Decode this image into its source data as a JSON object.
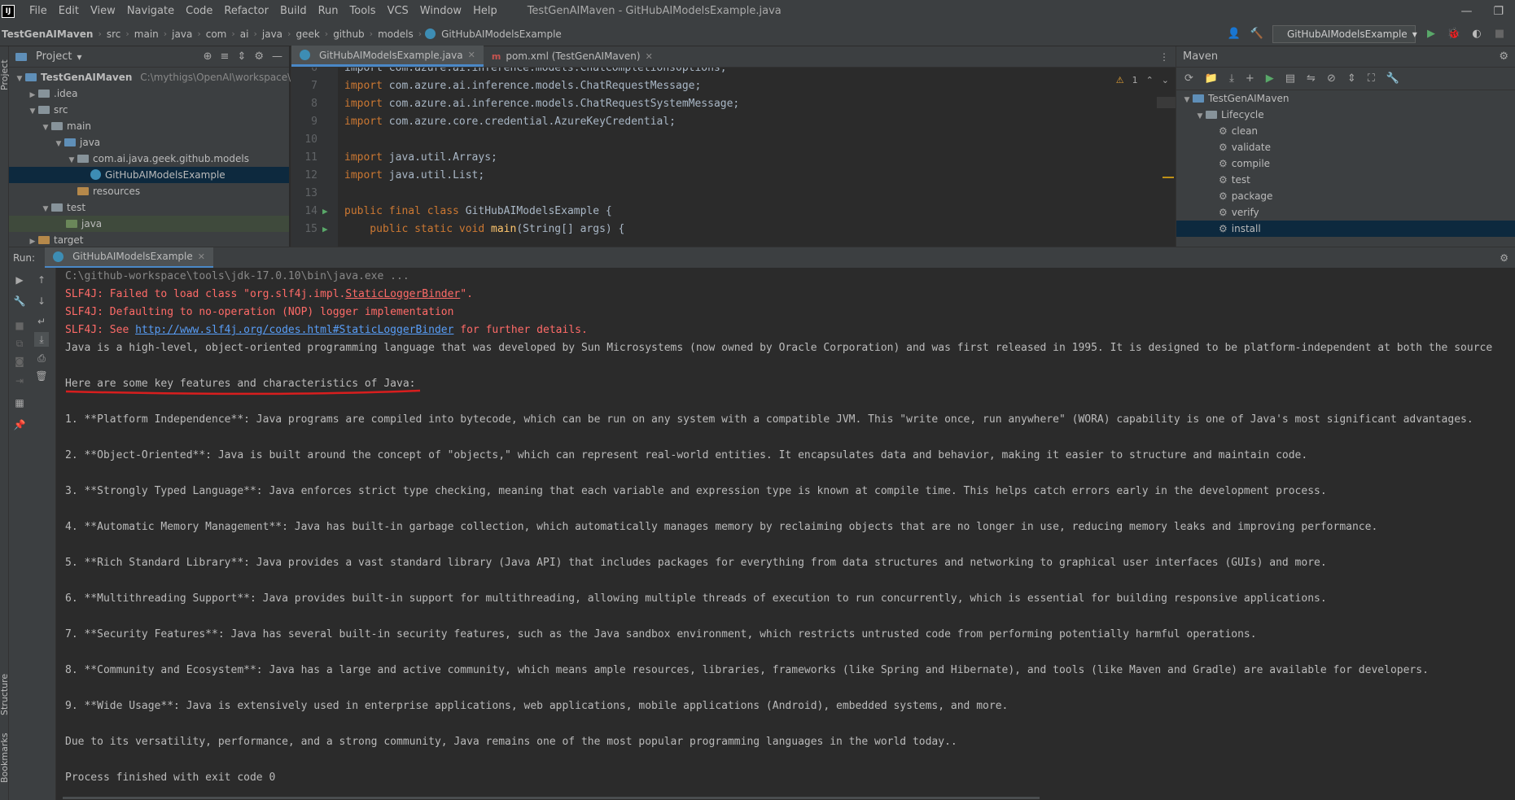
{
  "menubar": {
    "items": [
      "File",
      "Edit",
      "View",
      "Navigate",
      "Code",
      "Refactor",
      "Build",
      "Run",
      "Tools",
      "VCS",
      "Window",
      "Help"
    ],
    "window_title": "TestGenAIMaven - GitHubAIModelsExample.java"
  },
  "breadcrumb": [
    "TestGenAIMaven",
    "src",
    "main",
    "java",
    "com",
    "ai",
    "java",
    "geek",
    "github",
    "models",
    "GitHubAIModelsExample"
  ],
  "run_config": "GitHubAIModelsExample",
  "project": {
    "title": "Project",
    "root": "TestGenAIMaven",
    "root_path": "C:\\mythigs\\OpenAI\\workspace\\TestG",
    "items": [
      ".idea",
      "src",
      "main",
      "java",
      "com.ai.java.geek.github.models",
      "GitHubAIModelsExample",
      "resources",
      "test",
      "java",
      "target"
    ]
  },
  "editor": {
    "tabs": [
      "GitHubAIModelsExample.java",
      "pom.xml (TestGenAIMaven)"
    ],
    "warning_count": "1",
    "lines": [
      {
        "n": "6",
        "text": "import com.azure.ai.inference.models.ChatCompletionsOptions;"
      },
      {
        "n": "7",
        "text": "import com.azure.ai.inference.models.ChatRequestMessage;"
      },
      {
        "n": "8",
        "text": "import com.azure.ai.inference.models.ChatRequestSystemMessage;"
      },
      {
        "n": "9",
        "text": "import com.azure.core.credential.AzureKeyCredential;"
      },
      {
        "n": "10",
        "text": ""
      },
      {
        "n": "11",
        "text": "import java.util.Arrays;"
      },
      {
        "n": "12",
        "text": "import java.util.List;"
      },
      {
        "n": "13",
        "text": ""
      },
      {
        "n": "14",
        "text": "public final class GitHubAIModelsExample {"
      },
      {
        "n": "15",
        "text": "    public static void main(String[] args) {"
      }
    ]
  },
  "maven": {
    "title": "Maven",
    "project": "TestGenAIMaven",
    "lifecycle": "Lifecycle",
    "goals": [
      "clean",
      "validate",
      "compile",
      "test",
      "package",
      "verify",
      "install"
    ]
  },
  "run": {
    "label": "Run:",
    "tab": "GitHubAIModelsExample",
    "console": {
      "cmd": "C:\\github-workspace\\tools\\jdk-17.0.10\\bin\\java.exe ...",
      "err1_a": "SLF4J: Failed to load class \"org.slf4j.impl.",
      "err1_b": "StaticLoggerBinder",
      "err1_c": "\".",
      "err2": "SLF4J: Defaulting to no-operation (NOP) logger implementation",
      "err3_a": "SLF4J: See ",
      "err3_link": "http://www.slf4j.org/codes.html#StaticLoggerBinder",
      "err3_c": " for further details.",
      "intro": "Java is a high-level, object-oriented programming language that was developed by Sun Microsystems (now owned by Oracle Corporation) and was first released in 1995. It is designed to be platform-independent at both the source",
      "heading": "Here are some key features and characteristics of Java:",
      "points": [
        "1. **Platform Independence**: Java programs are compiled into bytecode, which can be run on any system with a compatible JVM. This \"write once, run anywhere\" (WORA) capability is one of Java's most significant advantages.",
        "2. **Object-Oriented**: Java is built around the concept of \"objects,\" which can represent real-world entities. It encapsulates data and behavior, making it easier to structure and maintain code.",
        "3. **Strongly Typed Language**: Java enforces strict type checking, meaning that each variable and expression type is known at compile time. This helps catch errors early in the development process.",
        "4. **Automatic Memory Management**: Java has built-in garbage collection, which automatically manages memory by reclaiming objects that are no longer in use, reducing memory leaks and improving performance.",
        "5. **Rich Standard Library**: Java provides a vast standard library (Java API) that includes packages for everything from data structures and networking to graphical user interfaces (GUIs) and more.",
        "6. **Multithreading Support**: Java provides built-in support for multithreading, allowing multiple threads of execution to run concurrently, which is essential for building responsive applications.",
        "7. **Security Features**: Java has several built-in security features, such as the Java sandbox environment, which restricts untrusted code from performing potentially harmful operations.",
        "8. **Community and Ecosystem**: Java has a large and active community, which means ample resources, libraries, frameworks (like Spring and Hibernate), and tools (like Maven and Gradle) are available for developers.",
        "9. **Wide Usage**: Java is extensively used in enterprise applications, web applications, mobile applications (Android), embedded systems, and more."
      ],
      "conclusion": "Due to its versatility, performance, and a strong community, Java remains one of the most popular programming languages in the world today..",
      "exit": "Process finished with exit code 0"
    }
  },
  "side_labels": {
    "project": "Project",
    "structure": "Structure",
    "bookmarks": "Bookmarks"
  },
  "colors": {
    "accent": "#4a88c7",
    "error": "#ff6b68",
    "link": "#589df6",
    "annotation": "#d81e1e"
  }
}
